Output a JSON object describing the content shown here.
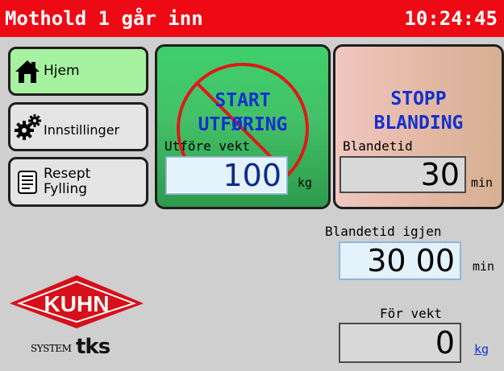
{
  "header": {
    "title": "Mothold 1 går inn",
    "time": "10:24:45"
  },
  "nav": {
    "home": {
      "label": "Hjem",
      "icon": "house-icon"
    },
    "settings": {
      "label": "Innstillinger",
      "icon": "gears-icon"
    },
    "recipe": {
      "label_line1": "Resept",
      "label_line2": "Fylling",
      "icon": "document-icon"
    }
  },
  "start": {
    "label": "START\nUTFØRING",
    "weight_label": "Utföre vekt",
    "weight_value": "100",
    "weight_unit": "kg",
    "disabled_icon": "prohibited-icon"
  },
  "stop": {
    "label": "STOPP\nBLANDING",
    "mix_label": "Blandetid",
    "mix_value": "30",
    "mix_unit": "min"
  },
  "remaining": {
    "label": "Blandetid igjen",
    "value": "30 00",
    "unit": "min"
  },
  "feed": {
    "label": "För vekt",
    "value": "0",
    "unit": "kg"
  },
  "branding": {
    "kuhn": "KUHN",
    "system": "SYSTEM",
    "tks": "tks"
  },
  "colors": {
    "title_bar": "#ee0a14",
    "start_green": "#43c168",
    "stop_peach": "#e3b8a4",
    "label_blue": "#1230d0",
    "kuhn_red": "#d6101a"
  }
}
